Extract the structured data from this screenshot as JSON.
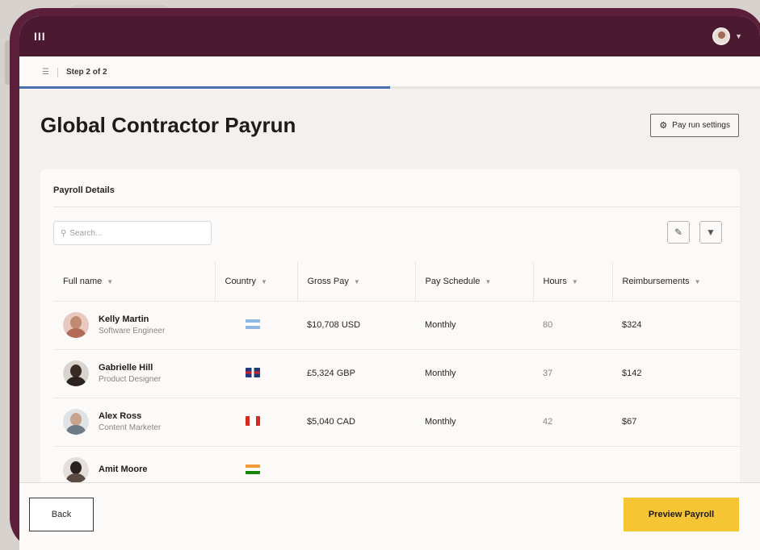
{
  "app": {
    "logo_text": "III",
    "step_label": "Step 2 of 2",
    "progress_percent": 50
  },
  "header": {
    "title": "Global Contractor Payrun",
    "settings_label": "Pay run settings"
  },
  "payroll": {
    "section_title": "Payroll Details",
    "search_placeholder": "Search...",
    "columns": [
      "Full name",
      "Country",
      "Gross Pay",
      "Pay Schedule",
      "Hours",
      "Reimbursements"
    ],
    "rows": [
      {
        "name": "Kelly Martin",
        "role": "Software Engineer",
        "country": "Argentina",
        "gross_pay": "$10,708 USD",
        "schedule": "Monthly",
        "hours": "80",
        "reimbursements": "$324"
      },
      {
        "name": "Gabrielle Hill",
        "role": "Product Designer",
        "country": "United Kingdom",
        "gross_pay": "£5,324 GBP",
        "schedule": "Monthly",
        "hours": "37",
        "reimbursements": "$142"
      },
      {
        "name": "Alex Ross",
        "role": "Content Marketer",
        "country": "Canada",
        "gross_pay": "$5,040 CAD",
        "schedule": "Monthly",
        "hours": "42",
        "reimbursements": "$67"
      },
      {
        "name": "Amit Moore",
        "role": "",
        "country": "India",
        "gross_pay": "",
        "schedule": "",
        "hours": "",
        "reimbursements": ""
      }
    ]
  },
  "footer": {
    "back_label": "Back",
    "preview_label": "Preview Payroll"
  },
  "colors": {
    "brand_dark": "#4b1a30",
    "frame": "#5b1f3a",
    "accent": "#f5c533",
    "progress": "#4a6fb0"
  },
  "icons": {
    "menu": "hamburger-icon",
    "settings": "gear-icon",
    "search": "search-icon",
    "edit": "pencil-icon",
    "filter": "filter-icon",
    "sort": "chevron-down-icon"
  }
}
